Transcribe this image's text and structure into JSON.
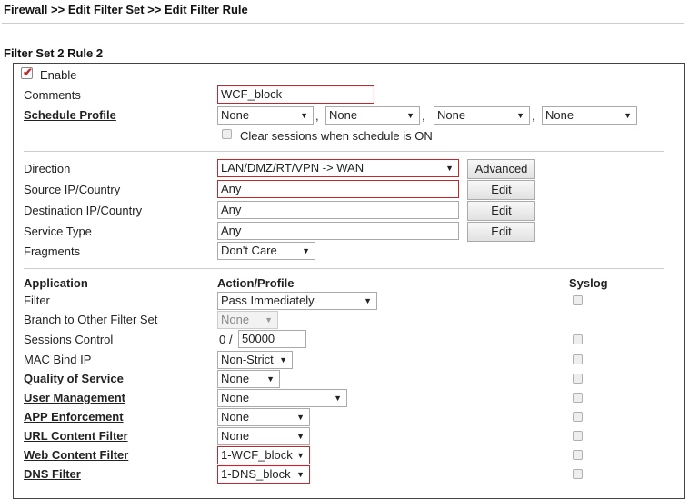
{
  "breadcrumb": "Firewall >> Edit Filter Set >> Edit Filter Rule",
  "section_title": "Filter Set 2 Rule 2",
  "enable": {
    "label": "Enable",
    "checked": true
  },
  "comments": {
    "label": "Comments",
    "value": "WCF_block"
  },
  "schedule": {
    "label": "Schedule Profile",
    "values": [
      "None",
      "None",
      "None",
      "None"
    ],
    "separator": ","
  },
  "clear_sessions": {
    "label": "Clear sessions when schedule is ON",
    "checked": false
  },
  "direction": {
    "label": "Direction",
    "value": "LAN/DMZ/RT/VPN -> WAN",
    "button": "Advanced"
  },
  "source": {
    "label": "Source IP/Country",
    "value": "Any",
    "button": "Edit"
  },
  "destination": {
    "label": "Destination IP/Country",
    "value": "Any",
    "button": "Edit"
  },
  "service": {
    "label": "Service Type",
    "value": "Any",
    "button": "Edit"
  },
  "fragments": {
    "label": "Fragments",
    "value": "Don't Care"
  },
  "headers": {
    "application": "Application",
    "action": "Action/Profile",
    "syslog": "Syslog"
  },
  "filter": {
    "label": "Filter",
    "value": "Pass Immediately"
  },
  "branch": {
    "label": "Branch to Other Filter Set",
    "value": "None"
  },
  "sessions": {
    "label": "Sessions Control",
    "current": "0",
    "separator": "/",
    "max": "50000"
  },
  "mac_bind": {
    "label": "MAC Bind IP",
    "value": "Non-Strict"
  },
  "qos": {
    "label": "Quality of Service",
    "value": "None"
  },
  "user_mgmt": {
    "label": "User Management",
    "value": "None"
  },
  "app_enf": {
    "label": "APP Enforcement",
    "value": "None"
  },
  "url_filter": {
    "label": "URL Content Filter",
    "value": "None"
  },
  "web_filter": {
    "label": "Web Content Filter",
    "value": "1-WCF_block"
  },
  "dns_filter": {
    "label": "DNS Filter",
    "value": "1-DNS_block"
  },
  "icons": {
    "caret": "dropdown-caret",
    "check": "checkmark"
  },
  "colors": {
    "highlight": "#c1272d"
  }
}
